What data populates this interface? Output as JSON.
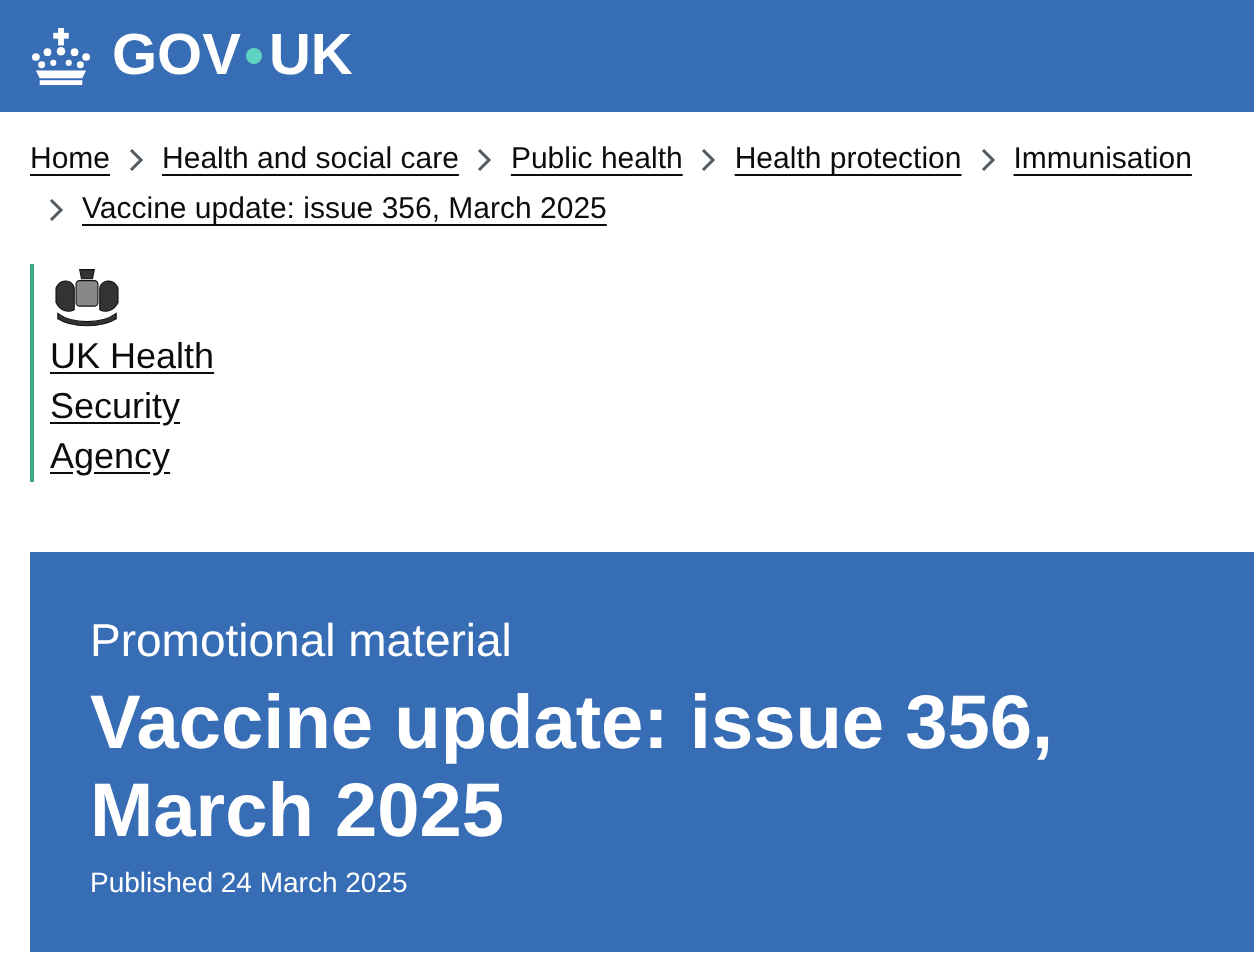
{
  "header": {
    "logo_left": "GOV",
    "logo_right": "UK"
  },
  "breadcrumbs": [
    {
      "label": "Home"
    },
    {
      "label": "Health and social care"
    },
    {
      "label": "Public health"
    },
    {
      "label": "Health protection"
    },
    {
      "label": "Immunisation"
    },
    {
      "label": "Vaccine update: issue 356, March 2025"
    }
  ],
  "organisation": {
    "lines": [
      "UK Health",
      "Security",
      "Agency"
    ]
  },
  "hero": {
    "type_label": "Promotional material",
    "title": "Vaccine update: issue 356, March 2025",
    "published": "Published 24 March 2025"
  }
}
